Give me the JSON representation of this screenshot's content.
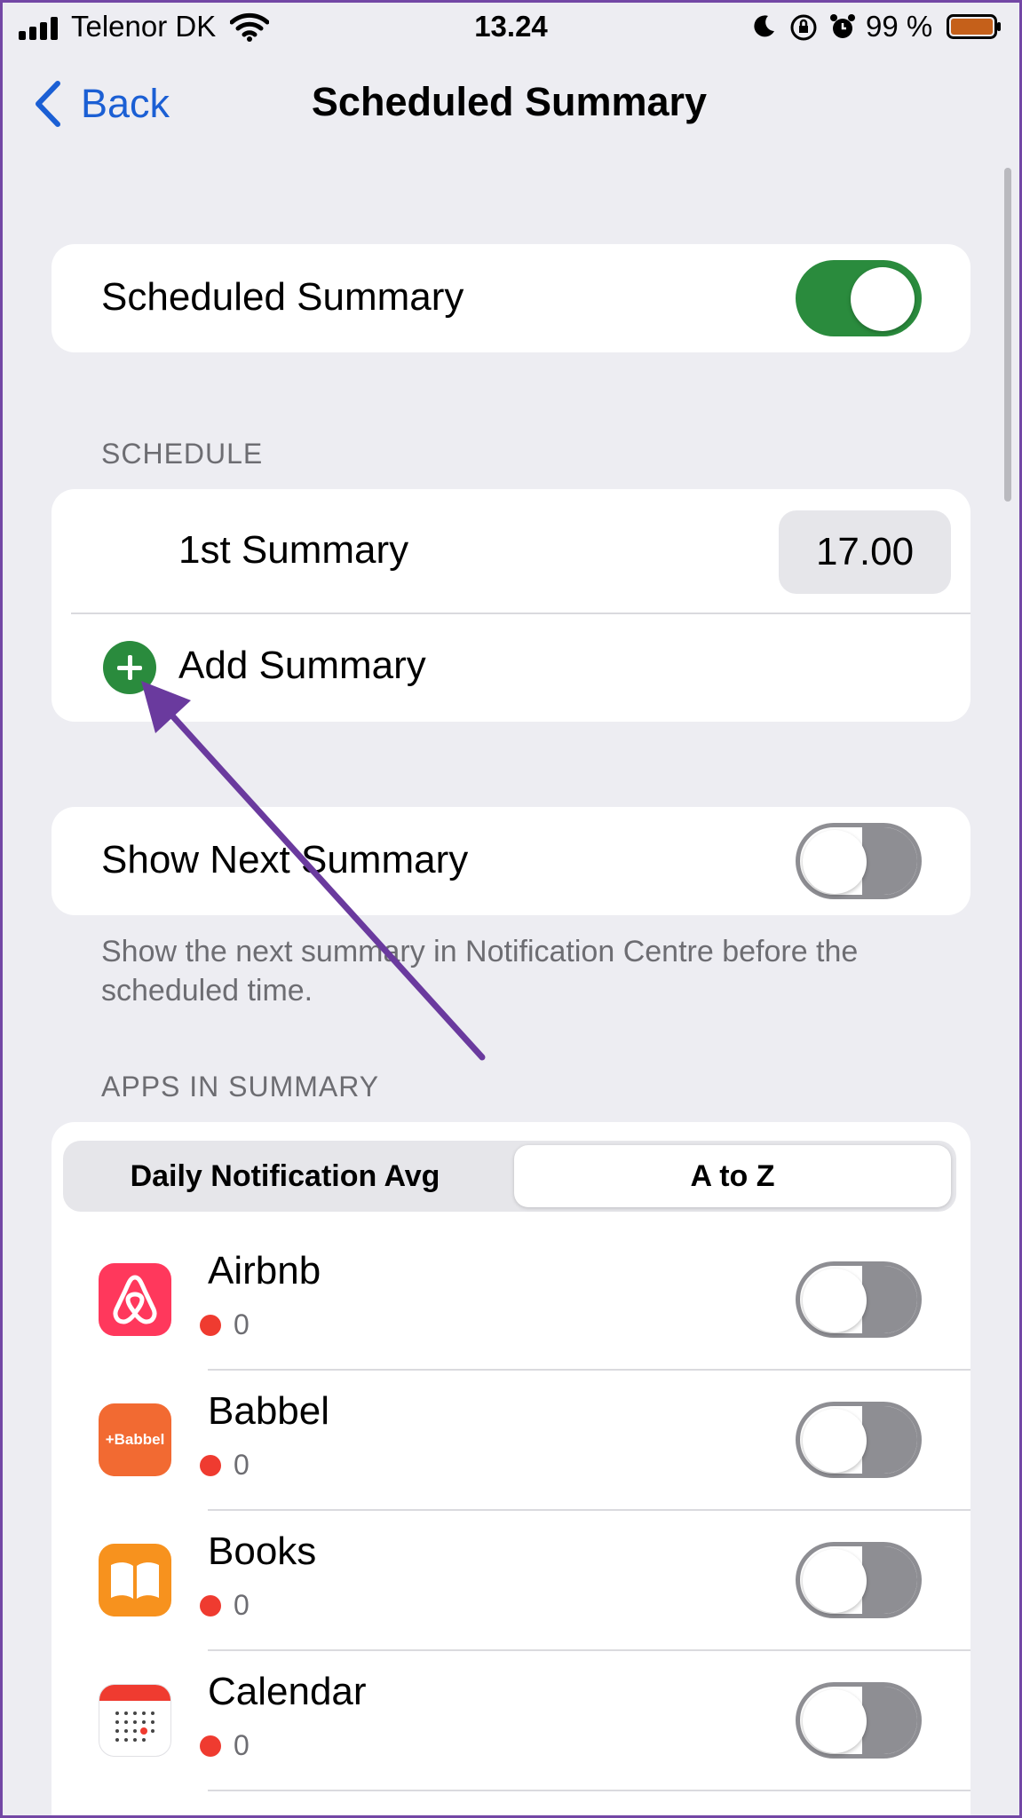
{
  "status_bar": {
    "carrier": "Telenor DK",
    "time": "13.24",
    "battery_percent": "99 %"
  },
  "nav": {
    "back_label": "Back",
    "title": "Scheduled Summary"
  },
  "scheduled_summary": {
    "label": "Scheduled Summary",
    "enabled": true
  },
  "schedule": {
    "header": "SCHEDULE",
    "first_summary_label": "1st Summary",
    "first_summary_time": "17.00",
    "add_summary_label": "Add Summary"
  },
  "show_next": {
    "label": "Show Next Summary",
    "enabled": false,
    "footer": "Show the next summary in Notification Centre before the scheduled time."
  },
  "apps": {
    "header": "APPS IN SUMMARY",
    "sort_options": [
      "Daily Notification Avg",
      "A to Z"
    ],
    "selected_sort": "A to Z",
    "items": [
      {
        "name": "Airbnb",
        "count": "0",
        "enabled": false,
        "icon": "airbnb-icon"
      },
      {
        "name": "Babbel",
        "count": "0",
        "enabled": false,
        "icon": "babbel-icon",
        "icon_text": "+Babbel"
      },
      {
        "name": "Books",
        "count": "0",
        "enabled": false,
        "icon": "books-icon"
      },
      {
        "name": "Calendar",
        "count": "0",
        "enabled": false,
        "icon": "calendar-icon"
      }
    ]
  },
  "colors": {
    "accent_blue": "#1b5fd4",
    "toggle_green": "#2a8b3d",
    "badge_red": "#ef3b30",
    "annotation_arrow": "#6a3a9e",
    "frame_border": "#7347a5"
  }
}
